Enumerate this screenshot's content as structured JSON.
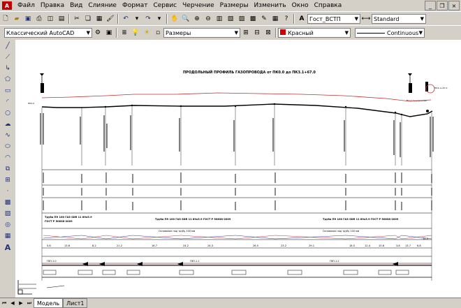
{
  "menu": {
    "items": [
      "Файл",
      "Правка",
      "Вид",
      "Слияние",
      "Формат",
      "Сервис",
      "Черчение",
      "Размеры",
      "Изменить",
      "Окно",
      "Справка"
    ]
  },
  "toolbar1": {
    "text_style": "Гост_ВСТП",
    "dim_style": "Standard"
  },
  "toolbar2": {
    "workspace": "Классический AutoCAD",
    "layer": "Размеры",
    "color": "Красный",
    "color_hex": "#d00000",
    "linetype": "Continuous"
  },
  "drawing": {
    "title": "ПРОДОЛЬНЫЙ ПРОФИЛЬ ГАЗОПРОВОДА от ПК0.0 до ПК3.1+67.0",
    "pipe_note_left_1": "Труба ПЭ 100 ГАЗ SDR 11 89х5.9",
    "pipe_note_left_2": "ГОСТ Р 50838-2009",
    "pipe_note_mid": "Труба ПЭ 100 ГАЗ SDR 11 89х5.9 ГОСТ Р 50838-2009",
    "pipe_note_right": "Труба ПЭ 100 ГАЗ SDR 11 89х5.9 ГОСТ Р 50838-2009",
    "marker_label_left": "ПК0.0",
    "marker_label_right": "ПК3.1+67.0",
    "right_note": "Ввод газопровода",
    "band_left_label": "Основание под трубу 100 мм",
    "band_right_label": "Основание под трубу 100 мм",
    "bottom_labels": [
      "ГВП-1.0",
      "ГВП-1.1",
      "ГВП-1.2"
    ],
    "segment_lengths": [
      "5.6",
      "13.6",
      "8.2",
      "21.2",
      "16.7",
      "24.2",
      "24.3",
      "26.5",
      "23.2",
      "29.1",
      "18.5",
      "12.4",
      "15.6",
      "3.8",
      "13.7",
      "6.8",
      "34.2"
    ]
  },
  "tabs": {
    "model": "Модель",
    "sheet": "Лист1"
  },
  "colors": {
    "ground_line": "#c03030",
    "pipe_line": "#000000",
    "accent": "#d00000"
  }
}
